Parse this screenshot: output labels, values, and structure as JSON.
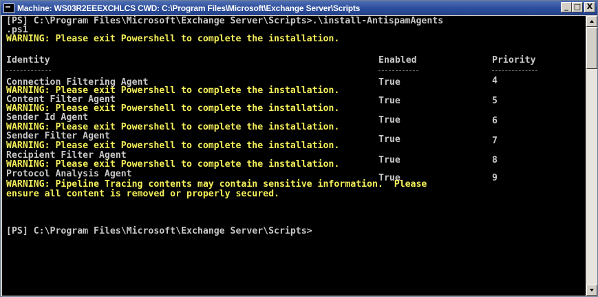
{
  "window": {
    "title": "Machine: WS03R2EEEXCHLCS CWD: C:\\Program Files\\Microsoft\\Exchange Server\\Scripts",
    "buttons": {
      "minimize": "_",
      "maximize": "□",
      "close": "X"
    }
  },
  "console": {
    "prompt_line_1": "[PS] C:\\Program Files\\Microsoft\\Exchange Server\\Scripts>.\\install-AntispamAgents",
    "prompt_line_2": ".ps1",
    "warning_exit": "WARNING: Please exit Powershell to complete the installation.",
    "columns": {
      "identity": "Identity",
      "enabled": "Enabled",
      "priority": "Priority"
    },
    "rows": [
      {
        "identity": "Connection Filtering Agent",
        "enabled": "True",
        "priority": "4"
      },
      {
        "identity": "Content Filter Agent",
        "enabled": "True",
        "priority": "5"
      },
      {
        "identity": "Sender Id Agent",
        "enabled": "True",
        "priority": "6"
      },
      {
        "identity": "Sender Filter Agent",
        "enabled": "True",
        "priority": "7"
      },
      {
        "identity": "Recipient Filter Agent",
        "enabled": "True",
        "priority": "8"
      },
      {
        "identity": "Protocol Analysis Agent",
        "enabled": "True",
        "priority": "9"
      }
    ],
    "warning_pipeline_1": "WARNING: Pipeline Tracing contents may contain sensitive information.  Please",
    "warning_pipeline_2": "ensure all content is removed or properly secured.",
    "final_prompt": "[PS] C:\\Program Files\\Microsoft\\Exchange Server\\Scripts>"
  },
  "colors": {
    "console_bg": "#000000",
    "console_text": "#c8c8c8",
    "warning_text": "#f5f05a",
    "titlebar": "#2e4f9d"
  }
}
